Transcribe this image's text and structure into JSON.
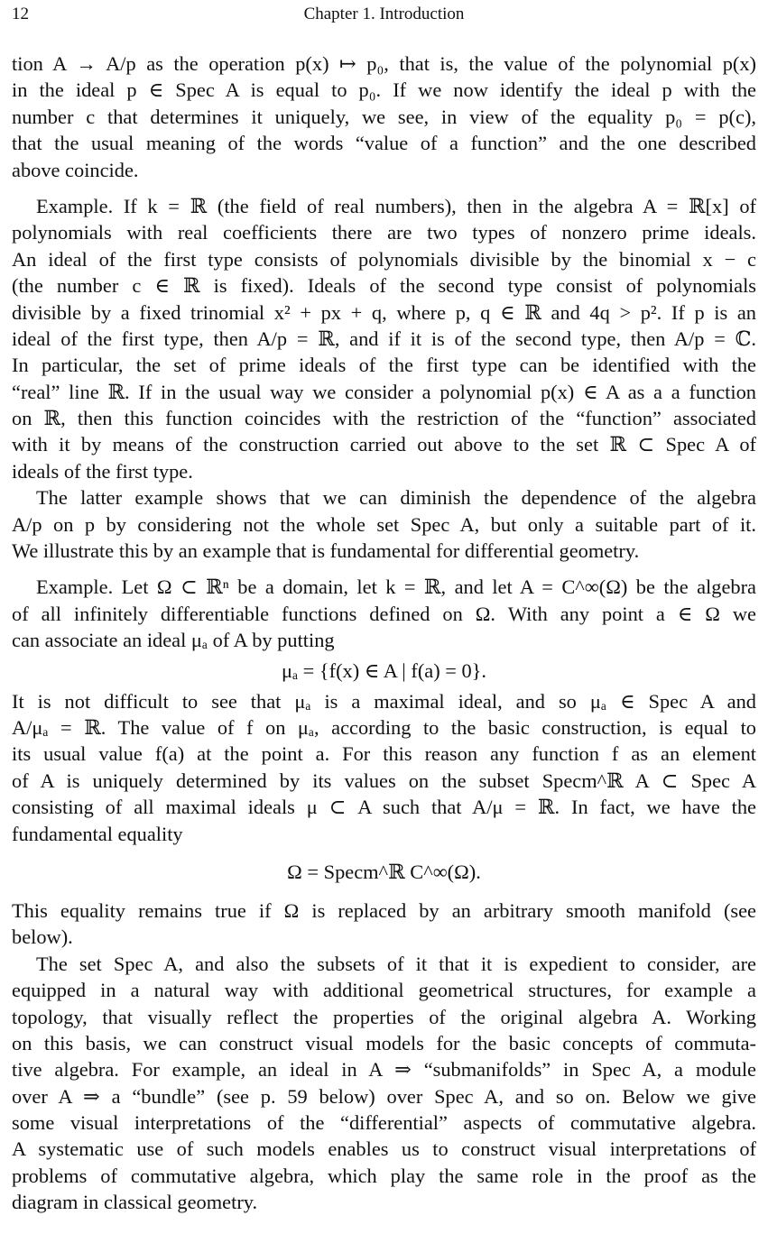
{
  "header": {
    "page_number": "12",
    "chapter_title": "Chapter 1. Introduction"
  },
  "paragraphs": [
    {
      "id": "p1",
      "indent": false,
      "lines": [
        "tion A → A/p as the operation p(x) ↦ p₀, that is, the value of the polynomial p(x)",
        "in the ideal p ∈ Spec A is equal to p₀. If we now identify the ideal p with the",
        "number c that determines it uniquely, we see, in view of the equality p₀ = p(c),",
        "that the usual meaning of the words “value of a function” and the one described",
        "above coincide."
      ]
    },
    {
      "id": "p2",
      "indent": true,
      "lines": [
        "Example. If k = ℝ (the field of real numbers), then in the algebra A = ℝ[x] of",
        "polynomials with real coefficients there are two types of nonzero prime ideals.",
        "An ideal of the first type consists of polynomials divisible by the binomial x − c",
        "(the number c ∈ ℝ is fixed). Ideals of the second type consist of polynomials",
        "divisible by a fixed trinomial x² + px + q, where p, q ∈ ℝ and 4q > p². If p is an",
        "ideal of the first type, then A/p = ℝ, and if it is of the second type, then A/p = ℂ.",
        "In particular, the set of prime ideals of the first type can be identified with the",
        "“real” line ℝ. If in the usual way we consider a polynomial p(x) ∈ A as a a function",
        "on ℝ, then this function coincides with the restriction of the “function” associated",
        "with it by means of the construction carried out above to the set ℝ ⊂ Spec A of",
        "ideals of the first type."
      ]
    },
    {
      "id": "p3",
      "indent": true,
      "lines": [
        "The latter example shows that we can diminish the dependence of the algebra",
        "A/p on p by considering not the whole set Spec A, but only a suitable part of it.",
        "We illustrate this by an example that is fundamental for differential geometry."
      ]
    },
    {
      "id": "p4",
      "indent": true,
      "lines": [
        "Example. Let Ω ⊂ ℝⁿ be a domain, let k = ℝ, and let A = C^∞(Ω) be the algebra",
        "of all infinitely differentiable functions defined on Ω. With any point a ∈ Ω we",
        "can associate an ideal μₐ of A by putting"
      ]
    },
    {
      "id": "eq1",
      "display": "μₐ = {f(x) ∈ A | f(a) = 0}."
    },
    {
      "id": "p5",
      "indent": false,
      "lines": [
        "It is not difficult to see that μₐ is a maximal ideal, and so μₐ ∈ Spec A and",
        "A/μₐ = ℝ. The value of f on μₐ, according to the basic construction, is equal to",
        "its usual value f(a) at the point a. For this reason any function f as an element",
        "of A is uniquely determined by its values on the subset Specm^ℝ A ⊂ Spec A",
        "consisting of all maximal ideals μ ⊂ A such that A/μ = ℝ. In fact, we have the",
        "fundamental equality"
      ]
    },
    {
      "id": "eq2",
      "display": "Ω = Specm^ℝ C^∞(Ω)."
    },
    {
      "id": "p6",
      "indent": false,
      "lines": [
        "This equality remains true if Ω is replaced by an arbitrary smooth manifold (see",
        "below)."
      ]
    },
    {
      "id": "p7",
      "indent": true,
      "lines": [
        "The set Spec A, and also the subsets of it that it is expedient to consider, are",
        "equipped in a natural way with additional geometrical structures, for example a",
        "topology, that visually reflect the properties of the original algebra A. Working",
        "on this basis, we can construct visual models for the basic concepts of commuta-",
        "tive algebra. For example, an ideal in A ⇒ “submanifolds” in Spec A, a module",
        "over A ⇒ a “bundle” (see p. 59 below) over Spec A, and so on. Below we give",
        "some visual interpretations of the “differential” aspects of commutative algebra.",
        "A systematic use of such models enables us to construct visual interpretations of",
        "problems of commutative algebra, which play the same role in the proof as the",
        "diagram in classical geometry."
      ]
    }
  ]
}
